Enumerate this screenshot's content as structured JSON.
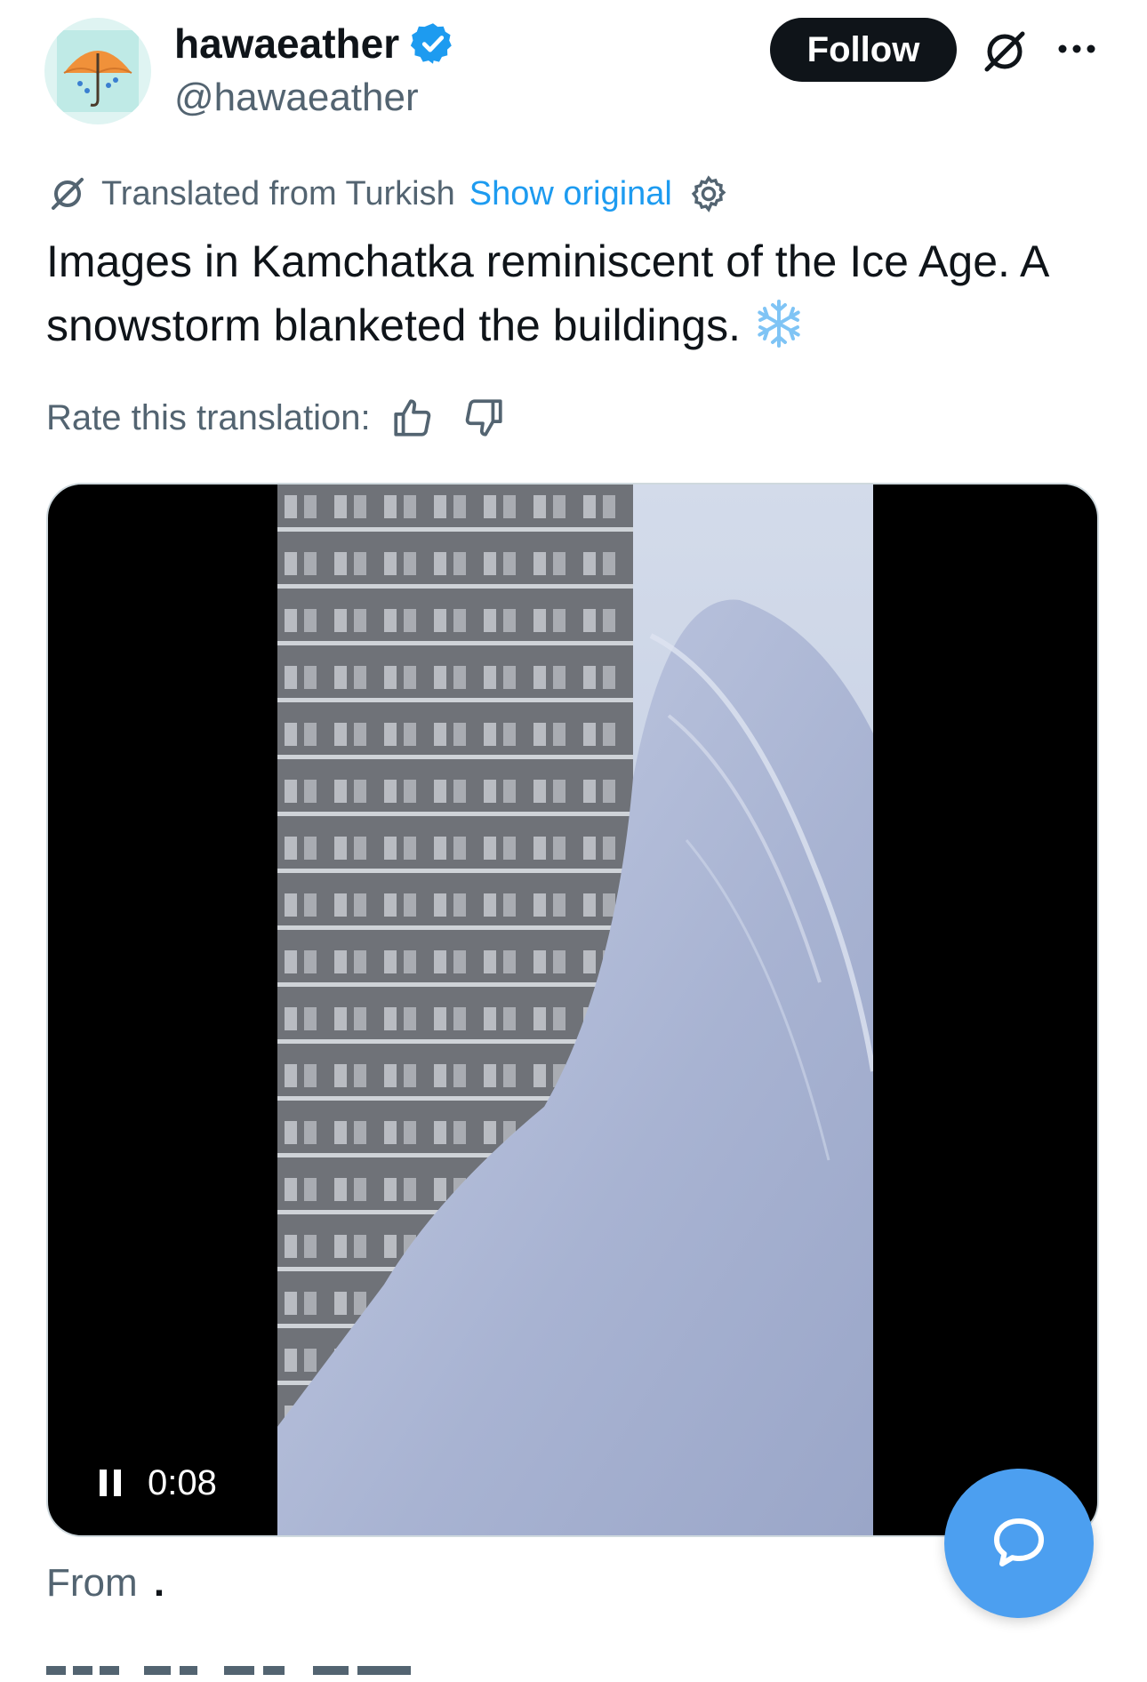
{
  "author": {
    "display_name": "hawaeather",
    "handle": "@hawaeather",
    "verified": true,
    "avatar_icon": "umbrella-avatar-icon"
  },
  "header": {
    "follow_label": "Follow",
    "grok_icon": "grok-icon",
    "more_icon": "more-icon"
  },
  "translation": {
    "label": "Translated from Turkish",
    "show_original": "Show original",
    "settings_icon": "gear-icon"
  },
  "tweet": {
    "text": "Images in Kamchatka reminiscent of the Ice Age. A snowstorm blanketed the buildings.",
    "emoji": "snowflake-icon"
  },
  "rating": {
    "label": "Rate this translation:",
    "up_icon": "thumbs-up-icon",
    "down_icon": "thumbs-down-icon"
  },
  "video": {
    "timestamp": "0:08",
    "state_icon": "pause-icon"
  },
  "source": {
    "from_label": "From",
    "from_value": "."
  },
  "colors": {
    "accent": "#1d9bf0",
    "fab": "#4c9ff0",
    "text": "#0f1419",
    "secondary": "#536471"
  }
}
